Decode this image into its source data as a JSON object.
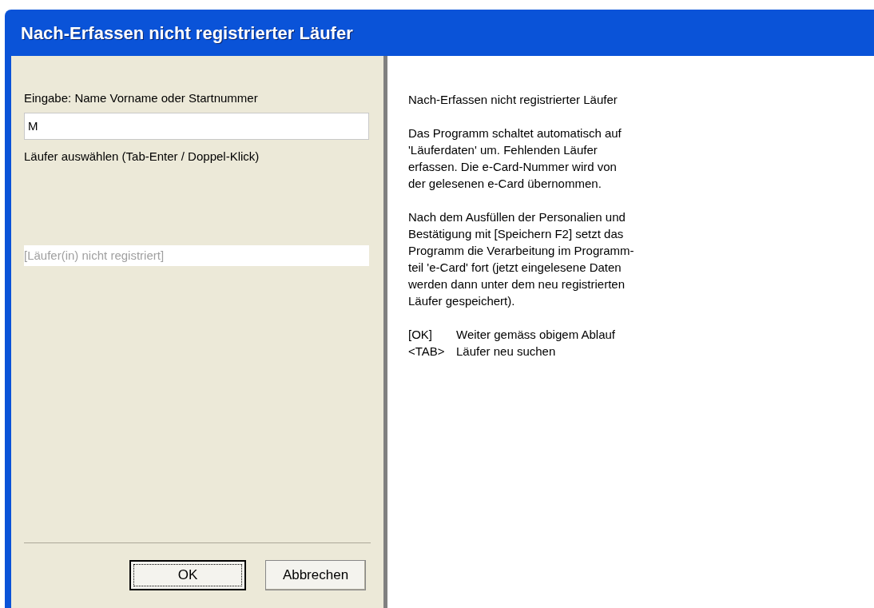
{
  "window": {
    "title": "Nach-Erfassen nicht registrierter Läufer"
  },
  "search": {
    "label": "Eingabe: Name Vorname oder Startnummer",
    "value": "M"
  },
  "list_label": "Läufer auswählen (Tab-Enter / Doppel-Klick)",
  "list_items": [
    {
      "text": "[Läufer(in) nicht registriert]",
      "disabled": true
    }
  ],
  "buttons": [
    {
      "label": "OK",
      "default": true
    },
    {
      "label": "Abbrechen",
      "default": false
    }
  ],
  "help": [
    {
      "lines": [
        "Nach-Erfassen nicht registrierter Läufer"
      ]
    },
    {
      "lines": [
        "Das Programm schaltet automatisch auf",
        "'Läuferdaten' um. Fehlenden Läufer",
        "erfassen. Die e-Card-Nummer wird von",
        "der gelesenen e-Card übernommen."
      ]
    },
    {
      "lines": [
        "Nach dem Ausfüllen der Personalien und",
        "Bestätigung mit [Speichern F2] setzt das",
        "Programm die Verarbeitung im Programm-",
        "teil 'e-Card' fort (jetzt eingelesene Daten",
        "werden dann unter dem neu registrierten",
        "Läufer gespeichert)."
      ]
    }
  ],
  "shortcuts": [
    {
      "key": "[OK]",
      "text": "Weiter gemäss obigem Ablauf"
    },
    {
      "key": "<TAB>",
      "text": "Läufer neu suchen"
    }
  ]
}
